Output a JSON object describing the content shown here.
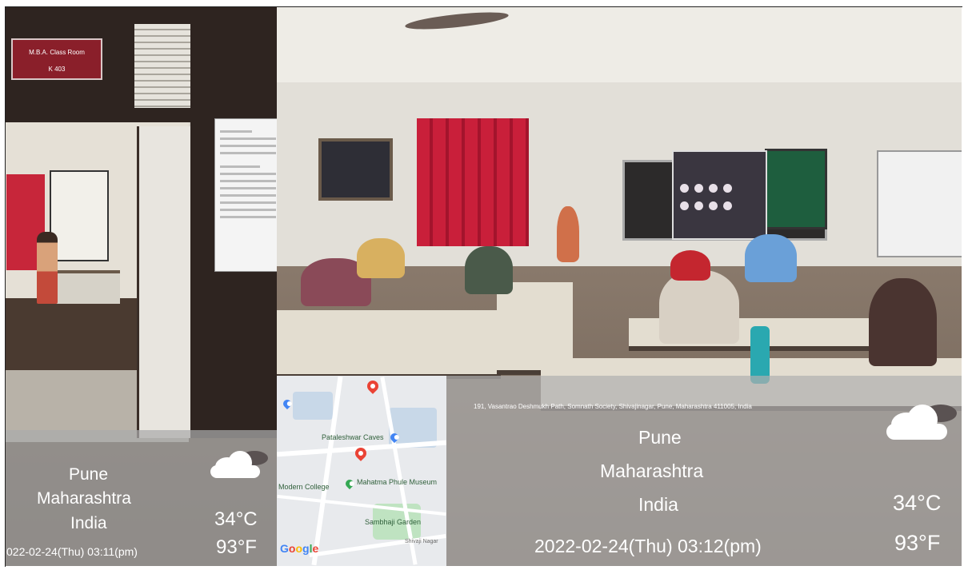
{
  "left_panel": {
    "room_sign": [
      "M.B.A. Class Room",
      "K 403"
    ],
    "weather": {
      "city": "Pune",
      "state": "Maharashtra",
      "country": "India",
      "temp_c": "34°C",
      "temp_f": "93°F",
      "datetime": "022-02-24(Thu)  03:11(pm)",
      "icon": "cloud-icon"
    }
  },
  "right_panel": {
    "weather": {
      "address": "191, Vasantrao Deshmukh Path, Somnath Society, Shivajinagar, Pune, Maharashtra 411005, India",
      "city": "Pune",
      "state": "Maharashtra",
      "country": "India",
      "temp_c": "34°C",
      "temp_f": "93°F",
      "datetime": "2022-02-24(Thu)   03:12(pm)",
      "icon": "cloud-icon"
    }
  },
  "map": {
    "labels": {
      "pataleshwar": "Pataleshwar Caves",
      "museum": "Mahatma Phule Museum",
      "college": "Modern College",
      "garden": "Sambhaji Garden",
      "shivaji": "Shivaji Nagar"
    },
    "logo": [
      "G",
      "o",
      "o",
      "g",
      "l",
      "e"
    ],
    "colors": {
      "pin_red": "#ea4335",
      "pin_green": "#34a853",
      "pin_blue": "#4285f4"
    }
  }
}
